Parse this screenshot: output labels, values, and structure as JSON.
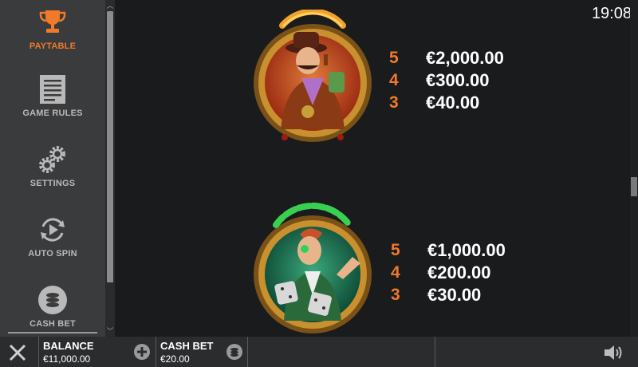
{
  "sidebar": {
    "items": [
      {
        "label": "PAYTABLE",
        "icon": "trophy-icon",
        "active": true
      },
      {
        "label": "GAME RULES",
        "icon": "document-icon",
        "active": false
      },
      {
        "label": "SETTINGS",
        "icon": "gears-icon",
        "active": false
      },
      {
        "label": "AUTO SPIN",
        "icon": "autospin-icon",
        "active": false
      },
      {
        "label": "CASH BET",
        "icon": "coins-icon",
        "active": false
      }
    ]
  },
  "clock": "19:08",
  "paytable": [
    {
      "symbol": "gentleman-with-pipe-symbol",
      "rows": [
        {
          "count": "5",
          "amount": "€2,000.00"
        },
        {
          "count": "4",
          "amount": "€300.00"
        },
        {
          "count": "3",
          "amount": "€40.00"
        }
      ]
    },
    {
      "symbol": "gambler-with-dice-symbol",
      "rows": [
        {
          "count": "5",
          "amount": "€1,000.00"
        },
        {
          "count": "4",
          "amount": "€200.00"
        },
        {
          "count": "3",
          "amount": "€30.00"
        }
      ]
    }
  ],
  "bottombar": {
    "balance_label": "BALANCE",
    "balance_value": "€11,000.00",
    "cashbet_label": "CASH BET",
    "cashbet_value": "€20.00"
  },
  "colors": {
    "accent": "#f07a2a",
    "sidebar_bg": "#3a3b3d",
    "main_bg": "#1a1b1d"
  }
}
